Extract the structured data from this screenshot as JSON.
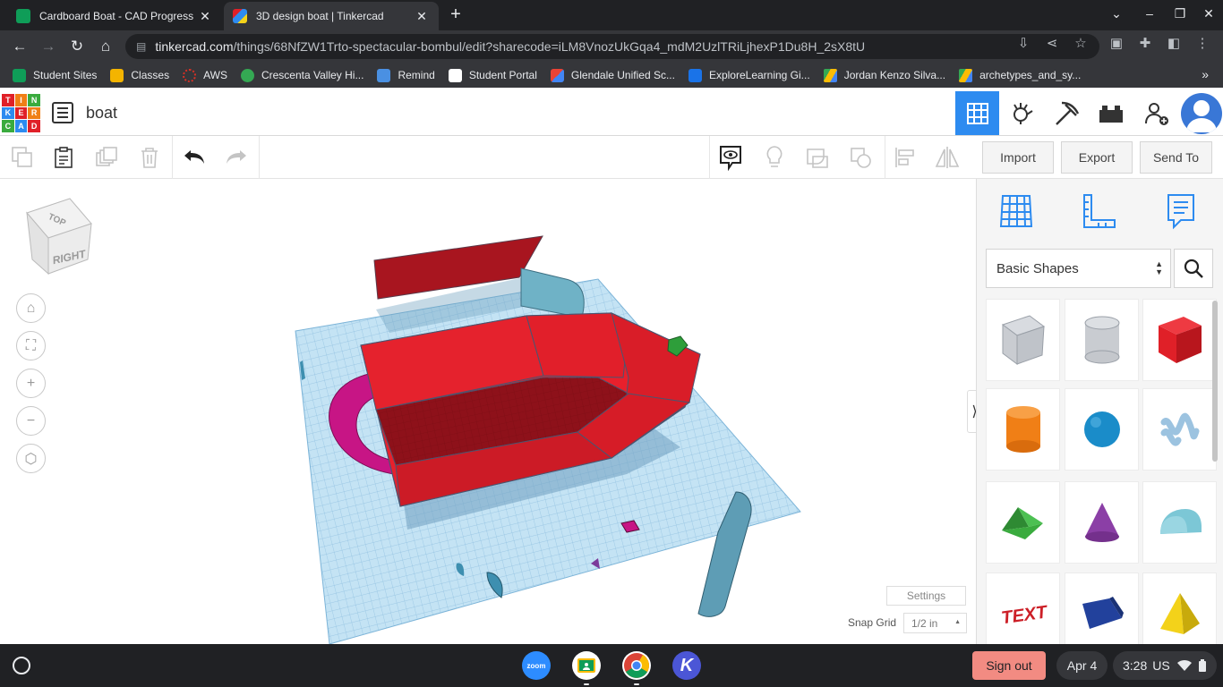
{
  "browser": {
    "tabs": [
      {
        "title": "Cardboard Boat - CAD Progress",
        "active": false,
        "favicon_color": "#0f9d58"
      },
      {
        "title": "3D design boat | Tinkercad",
        "active": true,
        "favicon_color": "#2d8bf0"
      }
    ],
    "url_host": "tinkercad.com",
    "url_path": "/things/68NfZW1Trto-spectacular-bombul/edit?sharecode=iLM8VnozUkGqa4_mdM2UzlTRiLjhexP1Du8H_2sX8tU",
    "bookmarks": [
      {
        "label": "Student Sites",
        "color": "#0f9d58"
      },
      {
        "label": "Classes",
        "color": "#f4b400"
      },
      {
        "label": "AWS",
        "color": "#d93025"
      },
      {
        "label": "Crescenta Valley Hi...",
        "color": "#34a853"
      },
      {
        "label": "Remind",
        "color": "#4a90e2"
      },
      {
        "label": "Student Portal",
        "color": "#ffffff"
      },
      {
        "label": "Glendale Unified Sc...",
        "color": "#ea4335"
      },
      {
        "label": "ExploreLearning Gi...",
        "color": "#1a73e8"
      },
      {
        "label": "Jordan Kenzo Silva...",
        "color": "#fbbc04"
      },
      {
        "label": "archetypes_and_sy...",
        "color": "#fbbc04"
      }
    ]
  },
  "app": {
    "logo_letters": [
      "T",
      "I",
      "N",
      "K",
      "E",
      "R",
      "C",
      "A",
      "D"
    ],
    "design_name": "boat",
    "header_icons": [
      "3d-design-icon",
      "circuits-icon",
      "minecraft-icon",
      "lego-bricks-icon",
      "invite-user-icon",
      "avatar"
    ],
    "actions": {
      "import": "Import",
      "export": "Export",
      "send_to": "Send To"
    }
  },
  "workplane": {
    "viewcube": {
      "top": "TOP",
      "right": "RIGHT"
    },
    "settings_label": "Settings",
    "snap_grid_label": "Snap Grid",
    "snap_grid_value": "1/2 in"
  },
  "shapes_panel": {
    "library": "Basic Shapes",
    "shapes": [
      {
        "name": "Box (hole)",
        "color": "#c9ccd1"
      },
      {
        "name": "Cylinder (hole)",
        "color": "#c9ccd1"
      },
      {
        "name": "Box",
        "color": "#e02028"
      },
      {
        "name": "Cylinder",
        "color": "#f07f16"
      },
      {
        "name": "Sphere",
        "color": "#1a8cc9"
      },
      {
        "name": "Scribble",
        "color": "#9cc3e0"
      },
      {
        "name": "Roof",
        "color": "#3aab3e"
      },
      {
        "name": "Cone",
        "color": "#8b3fa6"
      },
      {
        "name": "Round Roof",
        "color": "#7cc7d6"
      },
      {
        "name": "Text",
        "color": "#cc1f27"
      },
      {
        "name": "Half Sphere",
        "color": "#22419c"
      },
      {
        "name": "Pyramid",
        "color": "#f3d21a"
      }
    ]
  },
  "shelf": {
    "apps": [
      {
        "name": "Zoom",
        "label": "zoom",
        "color": "#2d8cff"
      },
      {
        "name": "Google Classroom",
        "label": "",
        "color": "#ffffff"
      },
      {
        "name": "Chrome",
        "label": "",
        "color": "#ffffff"
      },
      {
        "name": "Kami",
        "label": "K",
        "color": "#4b56d6"
      }
    ],
    "sign_out": "Sign out",
    "date": "Apr 4",
    "time": "3:28",
    "lang": "US"
  }
}
